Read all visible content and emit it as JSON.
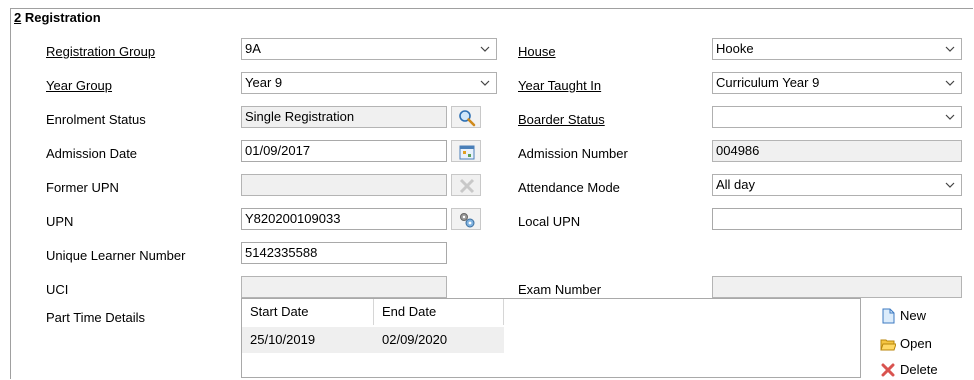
{
  "section": {
    "number": "2",
    "title": " Registration"
  },
  "left_fields": {
    "registration_group": {
      "label": "Registration Group",
      "value": "9A"
    },
    "year_group": {
      "label": "Year Group",
      "value": "Year  9"
    },
    "enrolment_status": {
      "label": "Enrolment Status",
      "value": "Single Registration"
    },
    "admission_date": {
      "label": "Admission Date",
      "value": "01/09/2017"
    },
    "former_upn": {
      "label": "Former UPN",
      "value": ""
    },
    "upn": {
      "label": "UPN",
      "value": "Y820200109033"
    },
    "uln": {
      "label": "Unique Learner Number",
      "value": "5142335588"
    },
    "uci": {
      "label": "UCI",
      "value": ""
    },
    "part_time": {
      "label": "Part Time Details"
    }
  },
  "right_fields": {
    "house": {
      "label": "House",
      "value": "Hooke"
    },
    "year_taught_in": {
      "label": "Year Taught In",
      "value": "Curriculum Year  9"
    },
    "boarder_status": {
      "label": "Boarder Status",
      "value": ""
    },
    "admission_number": {
      "label": "Admission Number",
      "value": "004986"
    },
    "attendance_mode": {
      "label": "Attendance Mode",
      "value": "All day"
    },
    "local_upn": {
      "label": "Local UPN",
      "value": ""
    },
    "exam_number": {
      "label": "Exam Number",
      "value": ""
    }
  },
  "part_time_table": {
    "columns": [
      "Start Date",
      "End Date"
    ],
    "rows": [
      [
        "25/10/2019",
        "02/09/2020"
      ]
    ]
  },
  "side_buttons": {
    "new": "New",
    "open": "Open",
    "delete": "Delete"
  }
}
